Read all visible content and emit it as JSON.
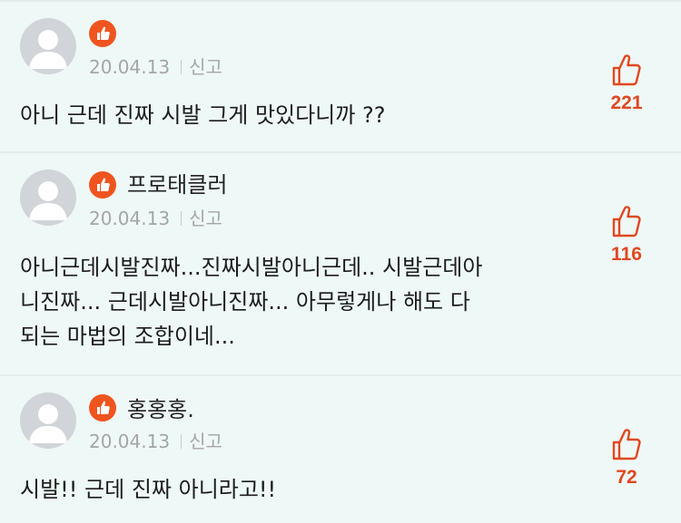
{
  "comments": [
    {
      "nickname": "",
      "date": "20.04.13",
      "report_label": "신고",
      "text": "아니 근데 진짜 시발 그게 맛있다니까 ??",
      "likes": "221"
    },
    {
      "nickname": "프로태클러",
      "date": "20.04.13",
      "report_label": "신고",
      "text": "아니근데시발진짜...진짜시발아니근데.. 시발근데아\n니진짜... 근데시발아니진짜... 아무렇게나 해도 다\n되는 마법의 조합이네...",
      "likes": "116"
    },
    {
      "nickname": "홍홍홍.",
      "date": "20.04.13",
      "report_label": "신고",
      "text": "시발!! 근데 진짜 아니라고!!",
      "likes": "72"
    }
  ],
  "colors": {
    "accent": "#e2471f",
    "badge": "#f0541e",
    "background": "#eef8f7",
    "meta_text": "#a5a5a5"
  },
  "icons": {
    "avatar": "default-avatar-icon",
    "badge": "thumbs-up-badge-icon",
    "like": "thumbs-up-outline-icon"
  }
}
